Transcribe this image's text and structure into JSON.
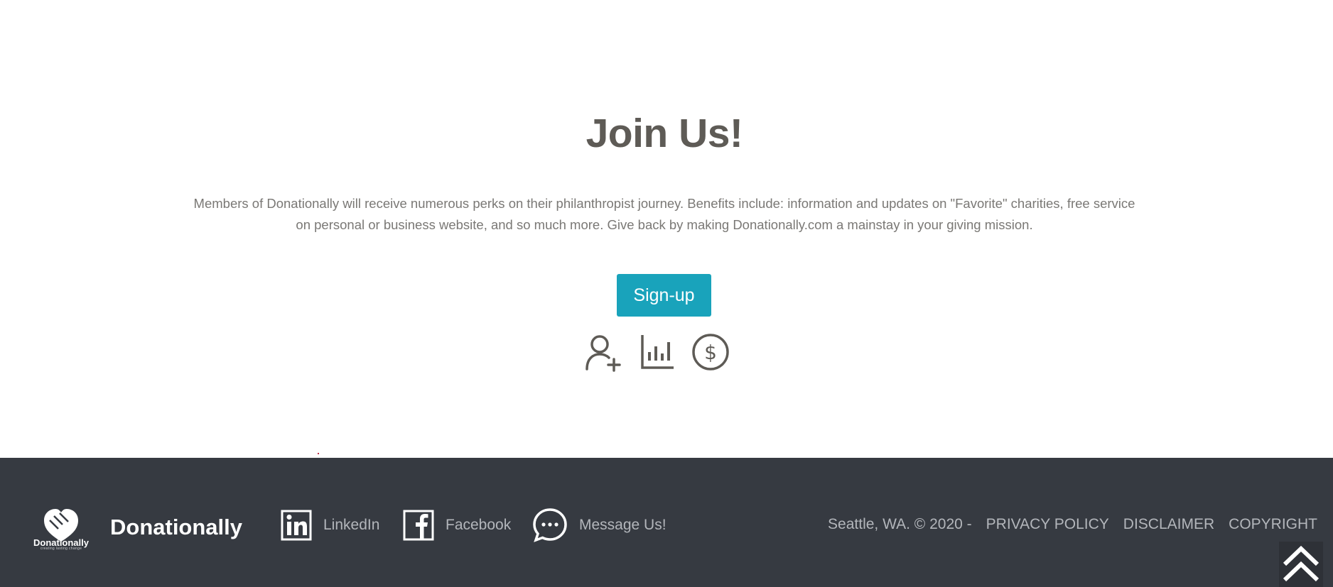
{
  "join": {
    "title": "Join Us!",
    "description": "Members of Donationally will receive numerous perks on their philanthropist journey. Benefits include: information and updates on \"Favorite\" charities, free service on personal or business website, and so much more. Give back by making Donationally.com a mainstay in your giving mission.",
    "signup_label": "Sign-up",
    "icons": [
      "add-user-icon",
      "bar-chart-icon",
      "dollar-circle-icon"
    ]
  },
  "footer": {
    "logo_word": "Donationally",
    "logo_tagline": "creating lasting change",
    "brand": "Donationally",
    "social": [
      {
        "label": "LinkedIn",
        "icon": "linkedin-icon"
      },
      {
        "label": "Facebook",
        "icon": "facebook-icon"
      },
      {
        "label": "Message Us!",
        "icon": "chat-bubble-icon"
      }
    ],
    "location": "Seattle, WA. © 2020 -",
    "links": [
      "PRIVACY POLICY",
      "DISCLAIMER",
      "COPYRIGHT"
    ],
    "scroll_top_icon": "double-chevron-up-icon"
  },
  "colors": {
    "title": "#5e5b56",
    "body_text": "#7a7875",
    "accent": "#19a3bb",
    "footer_bg": "#363a41",
    "footer_text": "#b3b6bb"
  }
}
